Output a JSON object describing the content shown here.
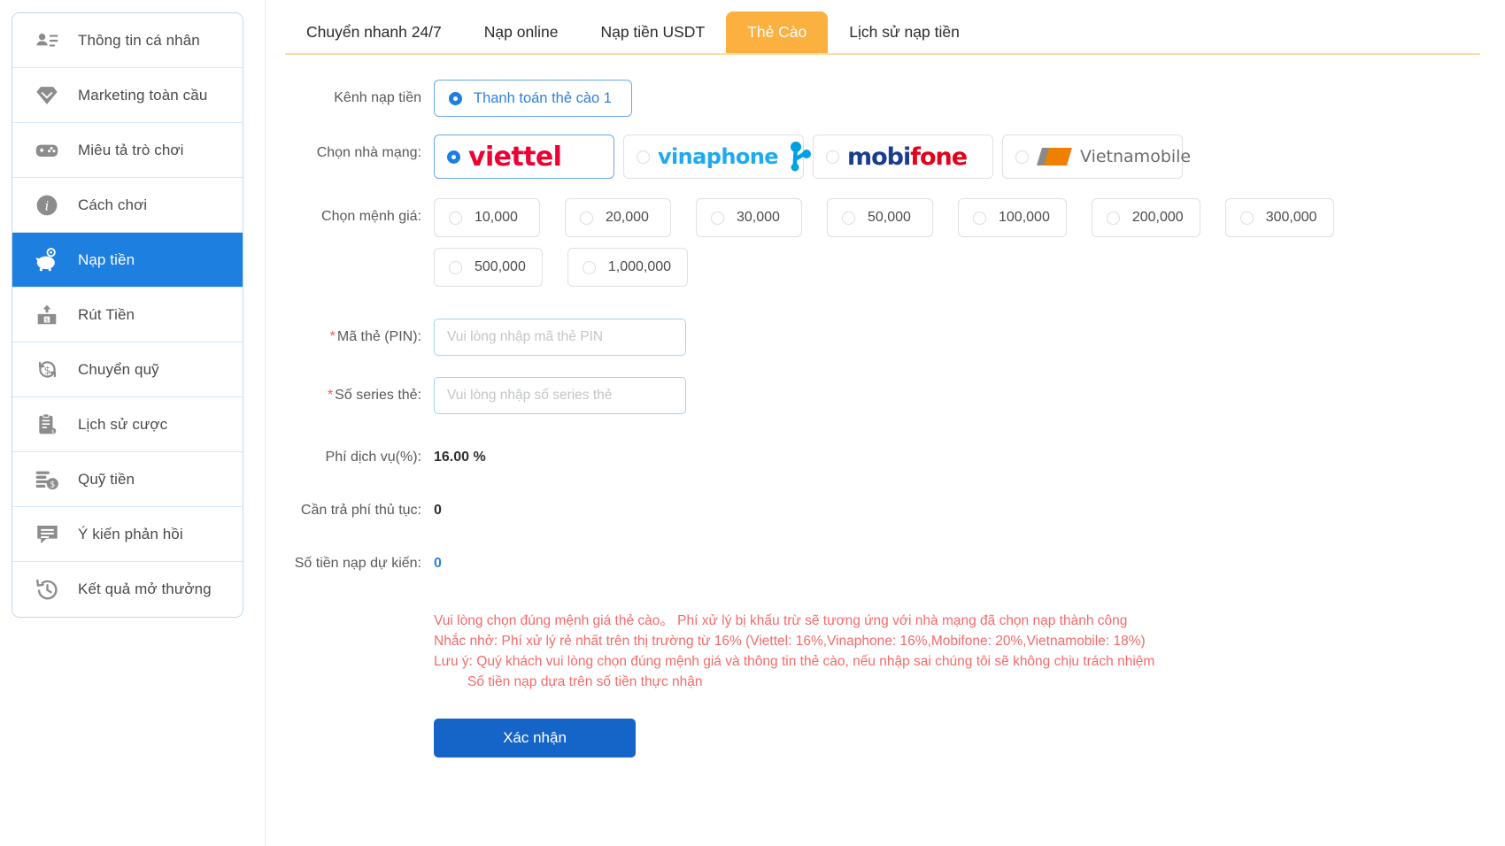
{
  "sidebar": {
    "items": [
      {
        "label": "Thông tin cá nhân",
        "icon": "user-card-icon",
        "active": false
      },
      {
        "label": "Marketing toàn cầu",
        "icon": "diamond-icon",
        "active": false
      },
      {
        "label": "Miêu tả trò chơi",
        "icon": "gamepad-icon",
        "active": false
      },
      {
        "label": "Cách chơi",
        "icon": "info-circle-icon",
        "active": false
      },
      {
        "label": "Nạp tiền",
        "icon": "piggy-bank-icon",
        "active": true
      },
      {
        "label": "Rút Tiền",
        "icon": "withdraw-icon",
        "active": false
      },
      {
        "label": "Chuyển quỹ",
        "icon": "transfer-dollar-icon",
        "active": false
      },
      {
        "label": "Lịch sử cược",
        "icon": "clipboard-icon",
        "active": false
      },
      {
        "label": "Quỹ tiền",
        "icon": "coins-dollar-icon",
        "active": false
      },
      {
        "label": "Ý kiến phản hồi",
        "icon": "chat-bubble-icon",
        "active": false
      },
      {
        "label": "Kết quả mở thưởng",
        "icon": "history-clock-icon",
        "active": false
      }
    ]
  },
  "tabs": [
    {
      "label": "Chuyển nhanh 24/7",
      "active": false
    },
    {
      "label": "Nạp online",
      "active": false
    },
    {
      "label": "Nạp tiền USDT",
      "active": false
    },
    {
      "label": "Thẻ Cào",
      "active": true
    },
    {
      "label": "Lịch sử nạp tiền",
      "active": false
    }
  ],
  "form": {
    "channel": {
      "label": "Kênh nạp tiền",
      "options": [
        {
          "label": "Thanh toán thẻ cào 1",
          "selected": true
        }
      ]
    },
    "carrier": {
      "label": "Chọn nhà mạng:",
      "options": [
        {
          "name": "viettel",
          "text": "viettel",
          "selected": true
        },
        {
          "name": "vinaphone",
          "text": "vinaphone",
          "selected": false
        },
        {
          "name": "mobifone",
          "text": "mobifone",
          "selected": false
        },
        {
          "name": "vietnamobile",
          "text": "Vietnamobile",
          "selected": false
        }
      ]
    },
    "denomination": {
      "label": "Chọn mệnh giá:",
      "options": [
        {
          "label": "10,000",
          "selected": false
        },
        {
          "label": "20,000",
          "selected": false
        },
        {
          "label": "30,000",
          "selected": false
        },
        {
          "label": "50,000",
          "selected": false
        },
        {
          "label": "100,000",
          "selected": false
        },
        {
          "label": "200,000",
          "selected": false
        },
        {
          "label": "300,000",
          "selected": false
        },
        {
          "label": "500,000",
          "selected": false
        },
        {
          "label": "1,000,000",
          "selected": false
        }
      ]
    },
    "pin": {
      "label": "Mã thẻ (PIN):",
      "required": true,
      "value": "",
      "placeholder": "Vui lòng nhập mã thẻ PIN"
    },
    "serial": {
      "label": "Số series thẻ:",
      "required": true,
      "value": "",
      "placeholder": "Vui lòng nhập số series thẻ"
    },
    "service_fee": {
      "label": "Phí dịch vụ(%):",
      "value": "16.00 %"
    },
    "handling_fee": {
      "label": "Cần trả phí thủ tục:",
      "value": "0"
    },
    "expected_amount": {
      "label": "Số tiền nạp dự kiến:",
      "value": "0"
    },
    "notes": [
      "Vui lòng chọn đúng mệnh giá thẻ cào。 Phí xử lý bị khấu trừ sẽ tương ứng với nhà mạng đã chọn nạp thành công",
      "Nhắc nhở: Phí xử lý rẻ nhất trên thị trường từ 16% (Viettel: 16%,Vinaphone: 16%,Mobifone: 20%,Vietnamobile: 18%)",
      "Lưu ý: Quý khách vui lòng chọn đúng mệnh giá và thông tin thẻ cào, nếu nhập sai chúng tôi sẽ không chịu trách nhiệm",
      "Số tiền nạp dựa trên số tiền thực nhận"
    ],
    "submit_label": "Xác nhận"
  },
  "colors": {
    "accent_blue": "#1d7fe0",
    "tab_active": "#fbb040",
    "note_red": "#f56a6a",
    "submit_blue": "#1565c9"
  }
}
